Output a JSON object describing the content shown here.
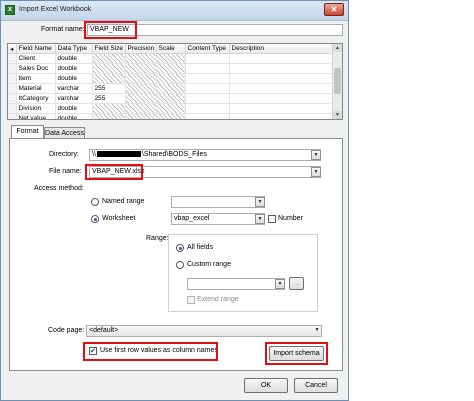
{
  "window": {
    "title": "Import Excel Workbook",
    "close_glyph": "✕"
  },
  "format_name": {
    "label": "Format name:",
    "value": "VBAP_NEW"
  },
  "schema_grid": {
    "columns": [
      "Field Name",
      "Data Type",
      "Field Size",
      "Precision",
      "Scale",
      "Content Type",
      "Description"
    ],
    "rows": [
      {
        "marker": "",
        "name": "Client",
        "type": "double",
        "size": ""
      },
      {
        "marker": "",
        "name": "Sales Doc",
        "type": "double",
        "size": ""
      },
      {
        "marker": "",
        "name": "Item",
        "type": "double",
        "size": ""
      },
      {
        "marker": "",
        "name": "Material",
        "type": "varchar",
        "size": "255"
      },
      {
        "marker": "",
        "name": "ItCategory",
        "type": "varchar",
        "size": "255"
      },
      {
        "marker": "",
        "name": "Division",
        "type": "double",
        "size": ""
      },
      {
        "marker": "",
        "name": "Net value",
        "type": "double",
        "size": ""
      }
    ]
  },
  "tabs": [
    {
      "label": "Format"
    },
    {
      "label": "Data Access"
    }
  ],
  "directory": {
    "label": "Directory:",
    "value_prefix": "\\\\",
    "value_suffix": "\\Shared\\BODS_Files"
  },
  "file_name": {
    "label": "File name:",
    "value": "VBAP_NEW.xlsx"
  },
  "access_method": {
    "label": "Access method:",
    "named_range": {
      "label": "Named range",
      "value": ""
    },
    "worksheet": {
      "label": "Worksheet",
      "value": "vbap_excel",
      "selected": true
    },
    "number": {
      "label": "Number"
    }
  },
  "range": {
    "label": "Range:",
    "all_fields": {
      "label": "All fields",
      "selected": true
    },
    "custom_range": {
      "label": "Custom range",
      "value": "",
      "browse_label": "..."
    },
    "extend_range": {
      "label": "Extend range"
    }
  },
  "code_page": {
    "label": "Code page:",
    "value": "<default>"
  },
  "first_row_names": {
    "label": "Use first row values as column names",
    "checked": true
  },
  "buttons": {
    "import_schema": "Import schema",
    "ok": "OK",
    "cancel": "Cancel"
  },
  "colors": {
    "highlight": "#e01010",
    "accent": "#1f5fae"
  }
}
